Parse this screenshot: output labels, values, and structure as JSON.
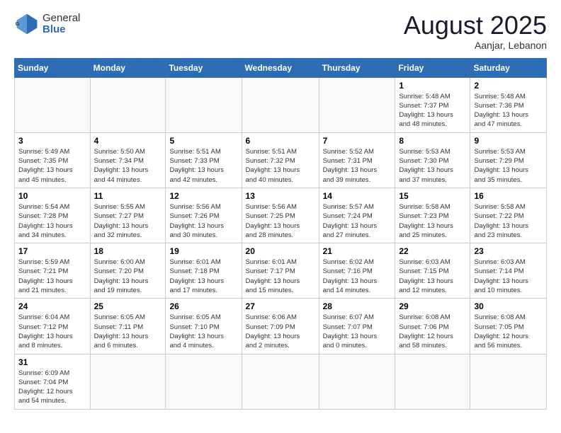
{
  "logo": {
    "general": "General",
    "blue": "Blue"
  },
  "header": {
    "month_year": "August 2025",
    "location": "Aanjar, Lebanon"
  },
  "weekdays": [
    "Sunday",
    "Monday",
    "Tuesday",
    "Wednesday",
    "Thursday",
    "Friday",
    "Saturday"
  ],
  "weeks": [
    [
      {
        "day": "",
        "info": ""
      },
      {
        "day": "",
        "info": ""
      },
      {
        "day": "",
        "info": ""
      },
      {
        "day": "",
        "info": ""
      },
      {
        "day": "",
        "info": ""
      },
      {
        "day": "1",
        "info": "Sunrise: 5:48 AM\nSunset: 7:37 PM\nDaylight: 13 hours\nand 48 minutes."
      },
      {
        "day": "2",
        "info": "Sunrise: 5:48 AM\nSunset: 7:36 PM\nDaylight: 13 hours\nand 47 minutes."
      }
    ],
    [
      {
        "day": "3",
        "info": "Sunrise: 5:49 AM\nSunset: 7:35 PM\nDaylight: 13 hours\nand 45 minutes."
      },
      {
        "day": "4",
        "info": "Sunrise: 5:50 AM\nSunset: 7:34 PM\nDaylight: 13 hours\nand 44 minutes."
      },
      {
        "day": "5",
        "info": "Sunrise: 5:51 AM\nSunset: 7:33 PM\nDaylight: 13 hours\nand 42 minutes."
      },
      {
        "day": "6",
        "info": "Sunrise: 5:51 AM\nSunset: 7:32 PM\nDaylight: 13 hours\nand 40 minutes."
      },
      {
        "day": "7",
        "info": "Sunrise: 5:52 AM\nSunset: 7:31 PM\nDaylight: 13 hours\nand 39 minutes."
      },
      {
        "day": "8",
        "info": "Sunrise: 5:53 AM\nSunset: 7:30 PM\nDaylight: 13 hours\nand 37 minutes."
      },
      {
        "day": "9",
        "info": "Sunrise: 5:53 AM\nSunset: 7:29 PM\nDaylight: 13 hours\nand 35 minutes."
      }
    ],
    [
      {
        "day": "10",
        "info": "Sunrise: 5:54 AM\nSunset: 7:28 PM\nDaylight: 13 hours\nand 34 minutes."
      },
      {
        "day": "11",
        "info": "Sunrise: 5:55 AM\nSunset: 7:27 PM\nDaylight: 13 hours\nand 32 minutes."
      },
      {
        "day": "12",
        "info": "Sunrise: 5:56 AM\nSunset: 7:26 PM\nDaylight: 13 hours\nand 30 minutes."
      },
      {
        "day": "13",
        "info": "Sunrise: 5:56 AM\nSunset: 7:25 PM\nDaylight: 13 hours\nand 28 minutes."
      },
      {
        "day": "14",
        "info": "Sunrise: 5:57 AM\nSunset: 7:24 PM\nDaylight: 13 hours\nand 27 minutes."
      },
      {
        "day": "15",
        "info": "Sunrise: 5:58 AM\nSunset: 7:23 PM\nDaylight: 13 hours\nand 25 minutes."
      },
      {
        "day": "16",
        "info": "Sunrise: 5:58 AM\nSunset: 7:22 PM\nDaylight: 13 hours\nand 23 minutes."
      }
    ],
    [
      {
        "day": "17",
        "info": "Sunrise: 5:59 AM\nSunset: 7:21 PM\nDaylight: 13 hours\nand 21 minutes."
      },
      {
        "day": "18",
        "info": "Sunrise: 6:00 AM\nSunset: 7:20 PM\nDaylight: 13 hours\nand 19 minutes."
      },
      {
        "day": "19",
        "info": "Sunrise: 6:01 AM\nSunset: 7:18 PM\nDaylight: 13 hours\nand 17 minutes."
      },
      {
        "day": "20",
        "info": "Sunrise: 6:01 AM\nSunset: 7:17 PM\nDaylight: 13 hours\nand 15 minutes."
      },
      {
        "day": "21",
        "info": "Sunrise: 6:02 AM\nSunset: 7:16 PM\nDaylight: 13 hours\nand 14 minutes."
      },
      {
        "day": "22",
        "info": "Sunrise: 6:03 AM\nSunset: 7:15 PM\nDaylight: 13 hours\nand 12 minutes."
      },
      {
        "day": "23",
        "info": "Sunrise: 6:03 AM\nSunset: 7:14 PM\nDaylight: 13 hours\nand 10 minutes."
      }
    ],
    [
      {
        "day": "24",
        "info": "Sunrise: 6:04 AM\nSunset: 7:12 PM\nDaylight: 13 hours\nand 8 minutes."
      },
      {
        "day": "25",
        "info": "Sunrise: 6:05 AM\nSunset: 7:11 PM\nDaylight: 13 hours\nand 6 minutes."
      },
      {
        "day": "26",
        "info": "Sunrise: 6:05 AM\nSunset: 7:10 PM\nDaylight: 13 hours\nand 4 minutes."
      },
      {
        "day": "27",
        "info": "Sunrise: 6:06 AM\nSunset: 7:09 PM\nDaylight: 13 hours\nand 2 minutes."
      },
      {
        "day": "28",
        "info": "Sunrise: 6:07 AM\nSunset: 7:07 PM\nDaylight: 13 hours\nand 0 minutes."
      },
      {
        "day": "29",
        "info": "Sunrise: 6:08 AM\nSunset: 7:06 PM\nDaylight: 12 hours\nand 58 minutes."
      },
      {
        "day": "30",
        "info": "Sunrise: 6:08 AM\nSunset: 7:05 PM\nDaylight: 12 hours\nand 56 minutes."
      }
    ],
    [
      {
        "day": "31",
        "info": "Sunrise: 6:09 AM\nSunset: 7:04 PM\nDaylight: 12 hours\nand 54 minutes."
      },
      {
        "day": "",
        "info": ""
      },
      {
        "day": "",
        "info": ""
      },
      {
        "day": "",
        "info": ""
      },
      {
        "day": "",
        "info": ""
      },
      {
        "day": "",
        "info": ""
      },
      {
        "day": "",
        "info": ""
      }
    ]
  ]
}
